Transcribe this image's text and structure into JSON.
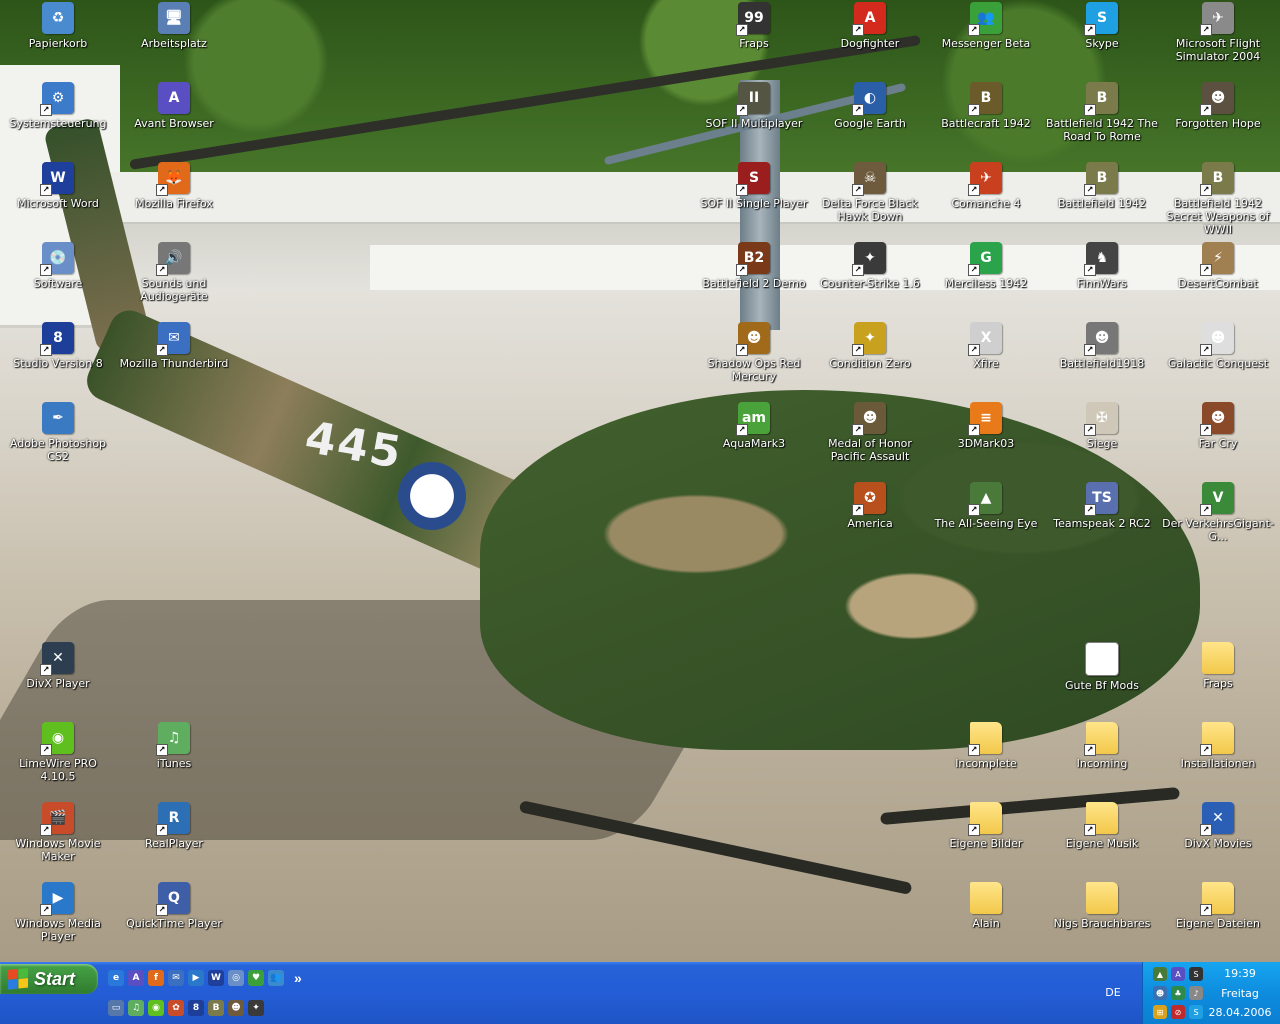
{
  "desktop": {
    "icons": [
      {
        "id": "papierkorb",
        "label": "Papierkorb",
        "glyph": "♻",
        "color": "#4a8bd0",
        "col": 0,
        "row": 0,
        "shortcut": false
      },
      {
        "id": "arbeitsplatz",
        "label": "Arbeitsplatz",
        "glyph": "🖥",
        "color": "#5a7fb5",
        "col": 1,
        "row": 0,
        "shortcut": false
      },
      {
        "id": "systemsteuerung",
        "label": "Systemsteuerung",
        "glyph": "⚙",
        "color": "#3c7bc9",
        "col": 0,
        "row": 1,
        "shortcut": true
      },
      {
        "id": "avant-browser",
        "label": "Avant Browser",
        "glyph": "A",
        "color": "#5a4fc2",
        "col": 1,
        "row": 1,
        "shortcut": false
      },
      {
        "id": "microsoft-word",
        "label": "Microsoft Word",
        "glyph": "W",
        "color": "#1f3f9c",
        "col": 0,
        "row": 2,
        "shortcut": true
      },
      {
        "id": "mozilla-firefox",
        "label": "Mozilla Firefox",
        "glyph": "🦊",
        "color": "#e06a1a",
        "col": 1,
        "row": 2,
        "shortcut": true
      },
      {
        "id": "software",
        "label": "Software",
        "glyph": "💿",
        "color": "#6a8fc8",
        "col": 0,
        "row": 3,
        "shortcut": true
      },
      {
        "id": "sounds",
        "label": "Sounds und Audiogeräte",
        "glyph": "🔊",
        "color": "#777777",
        "col": 1,
        "row": 3,
        "shortcut": true
      },
      {
        "id": "studio-version",
        "label": "Studio Version 8",
        "glyph": "8",
        "color": "#1e3f99",
        "col": 0,
        "row": 4,
        "shortcut": true
      },
      {
        "id": "mozilla-thunderbird",
        "label": "Mozilla Thunderbird",
        "glyph": "✉",
        "color": "#3b6fc1",
        "col": 1,
        "row": 4,
        "shortcut": true
      },
      {
        "id": "photoshop",
        "label": "Adobe Photoshop CS2",
        "glyph": "✒",
        "color": "#3a7ac2",
        "col": 0,
        "row": 5,
        "shortcut": false
      },
      {
        "id": "divx-player",
        "label": "DivX Player",
        "glyph": "✕",
        "color": "#2c3e50",
        "col": 0,
        "row": 8,
        "shortcut": true
      },
      {
        "id": "limewire",
        "label": "LimeWire PRO 4.10.5",
        "glyph": "◉",
        "color": "#5fbf1f",
        "col": 0,
        "row": 9,
        "shortcut": true
      },
      {
        "id": "itunes",
        "label": "iTunes",
        "glyph": "♫",
        "color": "#5fae5f",
        "col": 1,
        "row": 9,
        "shortcut": true
      },
      {
        "id": "movie-maker",
        "label": "Windows Movie Maker",
        "glyph": "🎬",
        "color": "#c84c2a",
        "col": 0,
        "row": 10,
        "shortcut": true
      },
      {
        "id": "realplayer",
        "label": "RealPlayer",
        "glyph": "R",
        "color": "#2d6fb5",
        "col": 1,
        "row": 10,
        "shortcut": true
      },
      {
        "id": "media-player",
        "label": "Windows Media Player",
        "glyph": "▶",
        "color": "#2a78c9",
        "col": 0,
        "row": 11,
        "shortcut": true
      },
      {
        "id": "quicktime",
        "label": "QuickTime Player",
        "glyph": "Q",
        "color": "#3e5fa8",
        "col": 1,
        "row": 11,
        "shortcut": true
      },
      {
        "id": "fraps-top",
        "label": "Fraps",
        "glyph": "99",
        "color": "#333333",
        "col": 6,
        "row": 0,
        "shortcut": true
      },
      {
        "id": "dogfighter",
        "label": "Dogfighter",
        "glyph": "A",
        "color": "#d42a1e",
        "col": 7,
        "row": 0,
        "shortcut": true
      },
      {
        "id": "messenger",
        "label": "Messenger Beta",
        "glyph": "👥",
        "color": "#3aa03a",
        "col": 8,
        "row": 0,
        "shortcut": true
      },
      {
        "id": "skype",
        "label": "Skype",
        "glyph": "S",
        "color": "#1fa0e3",
        "col": 9,
        "row": 0,
        "shortcut": true
      },
      {
        "id": "flight-sim",
        "label": "Microsoft Flight Simulator 2004",
        "glyph": "✈",
        "color": "#8a8a8a",
        "col": 10,
        "row": 0,
        "shortcut": true
      },
      {
        "id": "sof2-multi",
        "label": "SOF II Multiplayer",
        "glyph": "II",
        "color": "#555544",
        "col": 6,
        "row": 1,
        "shortcut": true
      },
      {
        "id": "google-earth",
        "label": "Google Earth",
        "glyph": "◐",
        "color": "#2a5fa8",
        "col": 7,
        "row": 1,
        "shortcut": true
      },
      {
        "id": "battlecraft",
        "label": "Battlecraft 1942",
        "glyph": "B",
        "color": "#6b5a2a",
        "col": 8,
        "row": 1,
        "shortcut": true
      },
      {
        "id": "bf-rome",
        "label": "Battlefield 1942 The Road To Rome",
        "glyph": "B",
        "color": "#7a7a4a",
        "col": 9,
        "row": 1,
        "shortcut": true
      },
      {
        "id": "forgotten-hope",
        "label": "Forgotten Hope",
        "glyph": "☻",
        "color": "#5c5140",
        "col": 10,
        "row": 1,
        "shortcut": true
      },
      {
        "id": "sof2-single",
        "label": "SOF II Single Player",
        "glyph": "S",
        "color": "#9a1e1e",
        "col": 6,
        "row": 2,
        "shortcut": true
      },
      {
        "id": "delta-force",
        "label": "Delta Force Black Hawk Down",
        "glyph": "☠",
        "color": "#6e5a3c",
        "col": 7,
        "row": 2,
        "shortcut": true
      },
      {
        "id": "comanche",
        "label": "Comanche 4",
        "glyph": "✈",
        "color": "#c9401e",
        "col": 8,
        "row": 2,
        "shortcut": true
      },
      {
        "id": "bf1942",
        "label": "Battlefield 1942",
        "glyph": "B",
        "color": "#7a7a4a",
        "col": 9,
        "row": 2,
        "shortcut": true
      },
      {
        "id": "bf-secret",
        "label": "Battlefield 1942 Secret Weapons of WWII",
        "glyph": "B",
        "color": "#7a7a4a",
        "col": 10,
        "row": 2,
        "shortcut": true
      },
      {
        "id": "bf2-demo",
        "label": "Battlefield 2 Demo",
        "glyph": "B2",
        "color": "#7a3a1a",
        "col": 6,
        "row": 3,
        "shortcut": true
      },
      {
        "id": "counter-strike",
        "label": "Counter-Strike 1.6",
        "glyph": "✦",
        "color": "#3a3a3a",
        "col": 7,
        "row": 3,
        "shortcut": true
      },
      {
        "id": "merciless",
        "label": "Merciless 1942",
        "glyph": "G",
        "color": "#2aa34a",
        "col": 8,
        "row": 3,
        "shortcut": true
      },
      {
        "id": "finnwars",
        "label": "FinnWars",
        "glyph": "♞",
        "color": "#444444",
        "col": 9,
        "row": 3,
        "shortcut": true
      },
      {
        "id": "desertcombat",
        "label": "DesertCombat",
        "glyph": "⚡",
        "color": "#a08050",
        "col": 10,
        "row": 3,
        "shortcut": true
      },
      {
        "id": "shadow-ops",
        "label": "Shadow Ops Red Mercury",
        "glyph": "☻",
        "color": "#a06a1a",
        "col": 6,
        "row": 4,
        "shortcut": true
      },
      {
        "id": "condition-zero",
        "label": "Condition Zero",
        "glyph": "✦",
        "color": "#c8a21e",
        "col": 7,
        "row": 4,
        "shortcut": true
      },
      {
        "id": "xfire",
        "label": "Xfire",
        "glyph": "X",
        "color": "#cfcfcf",
        "col": 8,
        "row": 4,
        "shortcut": true
      },
      {
        "id": "bf1918",
        "label": "Battlefield1918",
        "glyph": "☻",
        "color": "#777777",
        "col": 9,
        "row": 4,
        "shortcut": true
      },
      {
        "id": "galactic",
        "label": "Galactic Conquest",
        "glyph": "☻",
        "color": "#dedede",
        "col": 10,
        "row": 4,
        "shortcut": true
      },
      {
        "id": "aquamark",
        "label": "AquaMark3",
        "glyph": "am",
        "color": "#4aa33a",
        "col": 6,
        "row": 5,
        "shortcut": true
      },
      {
        "id": "moh-pacific",
        "label": "Medal of Honor Pacific Assault",
        "glyph": "☻",
        "color": "#6a5a3a",
        "col": 7,
        "row": 5,
        "shortcut": true
      },
      {
        "id": "3dmark",
        "label": "3DMark03",
        "glyph": "≡",
        "color": "#e87a1a",
        "col": 8,
        "row": 5,
        "shortcut": true
      },
      {
        "id": "siege",
        "label": "Siege",
        "glyph": "✠",
        "color": "#cfc8b8",
        "col": 9,
        "row": 5,
        "shortcut": true
      },
      {
        "id": "far-cry",
        "label": "Far Cry",
        "glyph": "☻",
        "color": "#8a4a2a",
        "col": 10,
        "row": 5,
        "shortcut": true
      },
      {
        "id": "america",
        "label": "America",
        "glyph": "✪",
        "color": "#b8501e",
        "col": 7,
        "row": 6,
        "shortcut": true
      },
      {
        "id": "all-seeing",
        "label": "The All-Seeing Eye",
        "glyph": "▲",
        "color": "#4a7a3a",
        "col": 8,
        "row": 6,
        "shortcut": true
      },
      {
        "id": "teamspeak",
        "label": "Teamspeak 2 RC2",
        "glyph": "TS",
        "color": "#5a6fae",
        "col": 9,
        "row": 6,
        "shortcut": true
      },
      {
        "id": "verkehrsgigant",
        "label": "Der VerkehrsGigant-G...",
        "glyph": "V",
        "color": "#3a8a3a",
        "col": 10,
        "row": 6,
        "shortcut": true
      },
      {
        "id": "gute-bf-mods",
        "label": "Gute Bf Mods",
        "glyph": "",
        "color": "doc",
        "col": 9,
        "row": 8,
        "shortcut": false
      },
      {
        "id": "fraps-folder",
        "label": "Fraps",
        "glyph": "",
        "color": "folder",
        "col": 10,
        "row": 8,
        "shortcut": false
      },
      {
        "id": "incomplete",
        "label": "Incomplete",
        "glyph": "",
        "color": "folder",
        "col": 8,
        "row": 9,
        "shortcut": true
      },
      {
        "id": "incoming",
        "label": "Incoming",
        "glyph": "",
        "color": "folder",
        "col": 9,
        "row": 9,
        "shortcut": true
      },
      {
        "id": "installationen",
        "label": "Installationen",
        "glyph": "",
        "color": "folder",
        "col": 10,
        "row": 9,
        "shortcut": true
      },
      {
        "id": "eigene-bilder",
        "label": "Eigene Bilder",
        "glyph": "",
        "color": "folder",
        "col": 8,
        "row": 10,
        "shortcut": true
      },
      {
        "id": "eigene-musik",
        "label": "Eigene Musik",
        "glyph": "",
        "color": "folder",
        "col": 9,
        "row": 10,
        "shortcut": true
      },
      {
        "id": "divx-movies",
        "label": "DivX Movies",
        "glyph": "✕",
        "color": "#2a5fb5",
        "col": 10,
        "row": 10,
        "shortcut": true
      },
      {
        "id": "alain",
        "label": "Alain",
        "glyph": "",
        "color": "folder",
        "col": 8,
        "row": 11,
        "shortcut": false
      },
      {
        "id": "nigs",
        "label": "Nigs Brauchbares",
        "glyph": "",
        "color": "folder",
        "col": 9,
        "row": 11,
        "shortcut": false
      },
      {
        "id": "eigene-dateien",
        "label": "Eigene Dateien",
        "glyph": "",
        "color": "folder",
        "col": 10,
        "row": 11,
        "shortcut": true
      }
    ],
    "wallpaper_text": "445"
  },
  "taskbar": {
    "start_label": "Start",
    "quicklaunch_row1": [
      {
        "id": "ql-ie",
        "glyph": "e",
        "color": "#2a78d9"
      },
      {
        "id": "ql-avant",
        "glyph": "A",
        "color": "#5a4fc2"
      },
      {
        "id": "ql-firefox",
        "glyph": "f",
        "color": "#e06a1a"
      },
      {
        "id": "ql-thunderbird",
        "glyph": "✉",
        "color": "#3b6fc1"
      },
      {
        "id": "ql-mediaplayer",
        "glyph": "▶",
        "color": "#2a78c9"
      },
      {
        "id": "ql-word",
        "glyph": "W",
        "color": "#1f3f9c"
      },
      {
        "id": "ql-software",
        "glyph": "◎",
        "color": "#6a8fc8"
      },
      {
        "id": "ql-messenger",
        "glyph": "♥",
        "color": "#3aa03a"
      },
      {
        "id": "ql-users",
        "glyph": "👥",
        "color": "#3a8ad0"
      }
    ],
    "quicklaunch_more": "»",
    "quicklaunch_row2": [
      {
        "id": "ql-desktop",
        "glyph": "▭",
        "color": "#5577aa"
      },
      {
        "id": "ql-itunes",
        "glyph": "♫",
        "color": "#5fae5f"
      },
      {
        "id": "ql-limewire",
        "glyph": "◉",
        "color": "#5fbf1f"
      },
      {
        "id": "ql-moviemaker",
        "glyph": "✿",
        "color": "#c84c2a"
      },
      {
        "id": "ql-studio",
        "glyph": "8",
        "color": "#1e3f99"
      },
      {
        "id": "ql-bf",
        "glyph": "B",
        "color": "#7a7a4a"
      },
      {
        "id": "ql-delta",
        "glyph": "☻",
        "color": "#6e5a3c"
      },
      {
        "id": "ql-cs",
        "glyph": "✦",
        "color": "#3a3a3a"
      }
    ],
    "language": "DE",
    "tray": {
      "time": "19:39",
      "day": "Freitag",
      "date": "28.04.2006",
      "icons": [
        {
          "id": "tray-eye",
          "glyph": "▲",
          "color": "#4a7a3a"
        },
        {
          "id": "tray-avant",
          "glyph": "A",
          "color": "#5a4fc2"
        },
        {
          "id": "tray-steam",
          "glyph": "S",
          "color": "#333333"
        },
        {
          "id": "tray-network",
          "glyph": "☻",
          "color": "#3a6fb0"
        },
        {
          "id": "tray-users",
          "glyph": "♣",
          "color": "#2e8a4a"
        },
        {
          "id": "tray-volume",
          "glyph": "♪",
          "color": "#888888"
        },
        {
          "id": "tray-win",
          "glyph": "⊞",
          "color": "#d8a21e"
        },
        {
          "id": "tray-safety",
          "glyph": "⊘",
          "color": "#c02a2a"
        },
        {
          "id": "tray-skype",
          "glyph": "S",
          "color": "#1fa0e3"
        }
      ]
    }
  }
}
